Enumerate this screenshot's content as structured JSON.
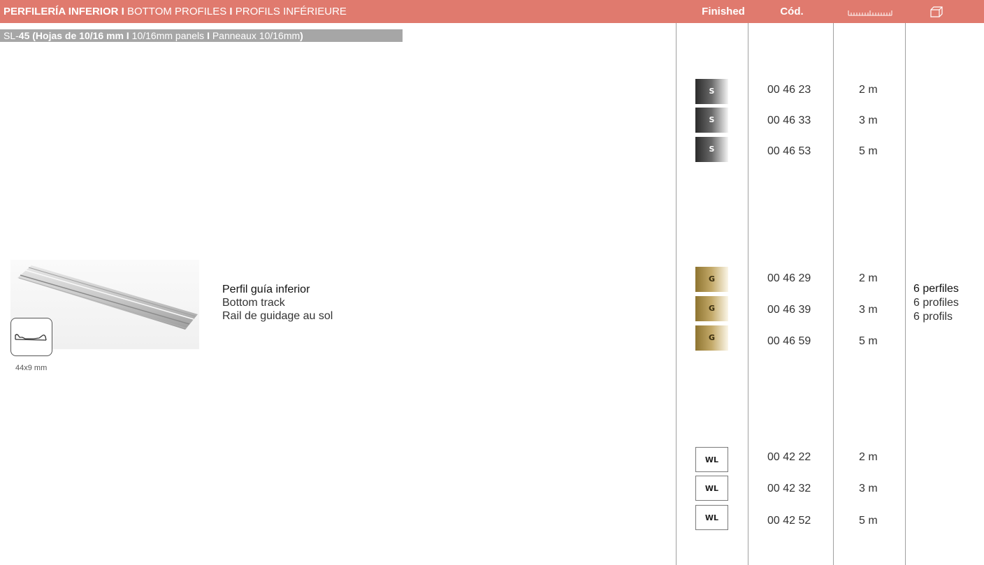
{
  "header": {
    "title_bold": "PERFILERÍA INFERIOR I",
    "title_rest": " BOTTOM PROFILES ",
    "title_sep": "I",
    "title_rest2": " PROFILS INFÉRIEURE",
    "col_finished": "Finished",
    "col_code": "Cód.",
    "col_length_icon": "ruler-icon",
    "col_pack_icon": "box-icon",
    "color": "#e07a6e"
  },
  "subheader": {
    "p1": "SL-",
    "p2": "45 (Hojas de 10/16 mm I",
    "p3": " 10/16mm panels ",
    "p4": "I",
    "p5": " Panneaux 10/16mm",
    "p6": ")"
  },
  "product": {
    "name_es": "Perfil guía inferior",
    "name_en": "Bottom track",
    "name_fr": "Rail de guidage au sol",
    "dimension": "44x9 mm",
    "image_icon": "aluminium-track-image",
    "profile_icon": "profile-section-icon"
  },
  "rows": [
    {
      "finish": "S",
      "code": "00 46 23",
      "length": "2 m"
    },
    {
      "finish": "S",
      "code": "00 46 33",
      "length": "3 m"
    },
    {
      "finish": "S",
      "code": "00 46 53",
      "length": "5 m"
    },
    {
      "finish": "G",
      "code": "00 46 29",
      "length": "2 m"
    },
    {
      "finish": "G",
      "code": "00 46 39",
      "length": "3 m"
    },
    {
      "finish": "G",
      "code": "00 46 59",
      "length": "5 m"
    },
    {
      "finish": "WL",
      "code": "00 42 22",
      "length": "2 m"
    },
    {
      "finish": "WL",
      "code": "00 42 32",
      "length": "3 m"
    },
    {
      "finish": "WL",
      "code": "00 42 52",
      "length": "5 m"
    }
  ],
  "packaging": {
    "es": "6 perfiles",
    "en": "6 profiles",
    "fr": "6 profils"
  }
}
